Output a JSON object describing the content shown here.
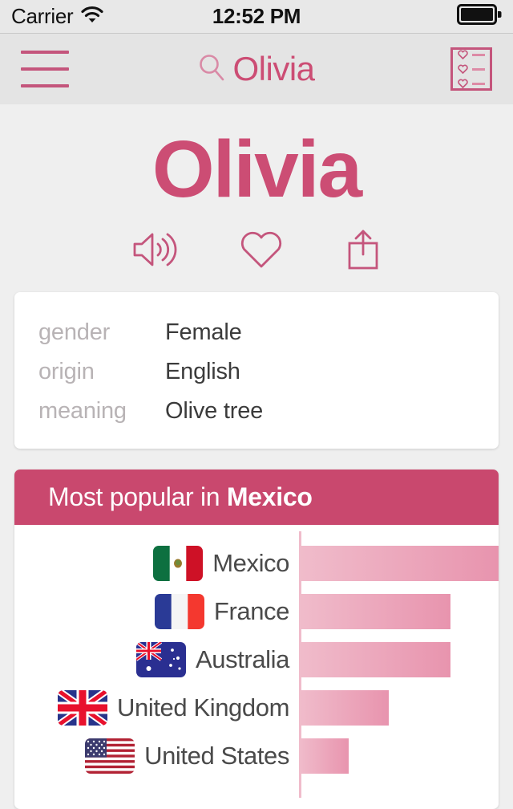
{
  "status_bar": {
    "carrier": "Carrier",
    "wifi_icon": "wifi-icon",
    "time": "12:52 PM",
    "battery_icon": "battery-full-icon"
  },
  "nav_bar": {
    "menu_icon": "hamburger-menu-icon",
    "search_icon": "search-icon",
    "search_value": "Olivia",
    "favorites_icon": "favorites-list-icon"
  },
  "hero": {
    "name": "Olivia",
    "actions": [
      {
        "icon": "speaker-pronounce-icon",
        "label": "Pronounce"
      },
      {
        "icon": "heart-favorite-icon",
        "label": "Favorite"
      },
      {
        "icon": "share-icon",
        "label": "Share"
      }
    ]
  },
  "info_card": {
    "rows": [
      {
        "label": "gender",
        "value": "Female"
      },
      {
        "label": "origin",
        "value": "English"
      },
      {
        "label": "meaning",
        "value": "Olive tree"
      }
    ]
  },
  "popular_card": {
    "header_prefix": "Most popular in ",
    "header_country": "Mexico"
  },
  "chart_data": {
    "type": "bar",
    "title": "Most popular in Mexico",
    "orientation": "horizontal",
    "categories": [
      "Mexico",
      "France",
      "Australia",
      "United Kingdom",
      "United States"
    ],
    "values": [
      100,
      76,
      76,
      45,
      25
    ],
    "flags": [
      "flag-mexico",
      "flag-france",
      "flag-australia",
      "flag-united-kingdom",
      "flag-united-states"
    ],
    "xlabel": "",
    "ylabel": "",
    "xlim": [
      0,
      100
    ],
    "grid": false,
    "legend": "none",
    "bar_color_start": "#f0bccb",
    "bar_color_end": "#e894ae"
  },
  "colors": {
    "accent_pink": "#cc4d74",
    "header_pink": "#c9486e",
    "page_background": "#efefef",
    "nav_background": "#e4e4e4",
    "status_background": "#e8e8e8",
    "card_background": "#ffffff",
    "label_gray": "#b8b3b5",
    "value_gray": "#3b3b3b"
  }
}
